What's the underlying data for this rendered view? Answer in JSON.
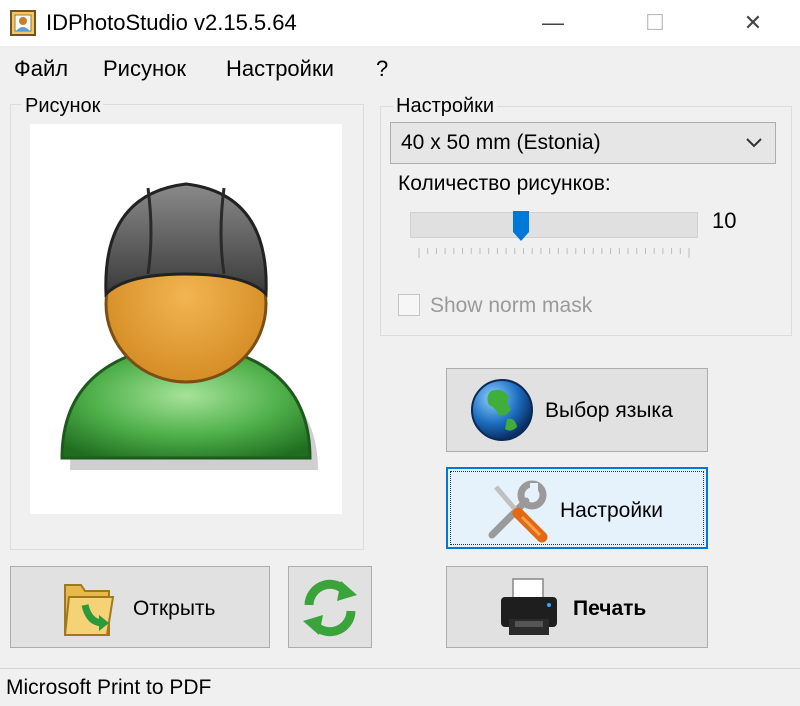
{
  "window": {
    "title": "IDPhotoStudio v2.15.5.64",
    "minimize_glyph": "—",
    "maximize_glyph": "☐",
    "close_glyph": "✕"
  },
  "menu": {
    "items": [
      "Файл",
      "Рисунок",
      "Настройки",
      "?"
    ]
  },
  "picture_group": {
    "label": "Рисунок"
  },
  "settings_group": {
    "label": "Настройки",
    "format_selected": "40 x 50 mm (Estonia)",
    "count_label": "Количество рисунков:",
    "count_value": "10",
    "slider_fraction": 0.38,
    "show_norm_mask_label": "Show norm mask",
    "show_norm_mask_checked": false
  },
  "buttons": {
    "language": "Выбор языка",
    "settings": "Настройки",
    "open": "Открыть",
    "print": "Печать"
  },
  "status": {
    "printer": "Microsoft Print to PDF"
  },
  "icons": {
    "app": "app-icon",
    "globe": "globe-icon",
    "tools": "tools-icon",
    "folder": "folder-open-icon",
    "refresh": "refresh-icon",
    "printer": "printer-icon"
  },
  "colors": {
    "accent_focus": "#0078d7",
    "slider_thumb": "#0078d7",
    "shirt": "#45a845",
    "face": "#e9a73a",
    "hat": "#4d4d4d"
  }
}
